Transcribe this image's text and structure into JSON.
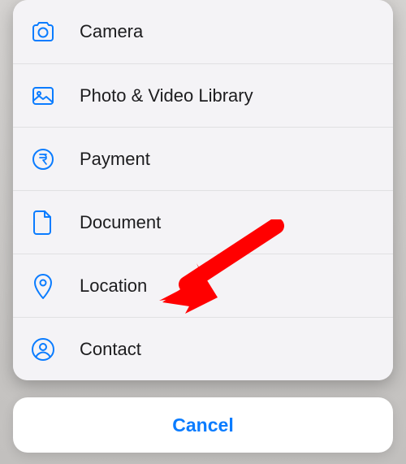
{
  "menu": {
    "items": [
      {
        "icon": "camera-icon",
        "label": "Camera"
      },
      {
        "icon": "photo-icon",
        "label": "Photo & Video Library"
      },
      {
        "icon": "payment-icon",
        "label": "Payment"
      },
      {
        "icon": "document-icon",
        "label": "Document"
      },
      {
        "icon": "location-icon",
        "label": "Location"
      },
      {
        "icon": "contact-icon",
        "label": "Contact"
      }
    ]
  },
  "cancel_label": "Cancel",
  "annotation": {
    "arrow_points_to": "location",
    "arrow_color": "#ff0000"
  },
  "colors": {
    "accent": "#0a7cff",
    "sheet_bg": "#f4f3f6",
    "text": "#1c1c1e"
  }
}
